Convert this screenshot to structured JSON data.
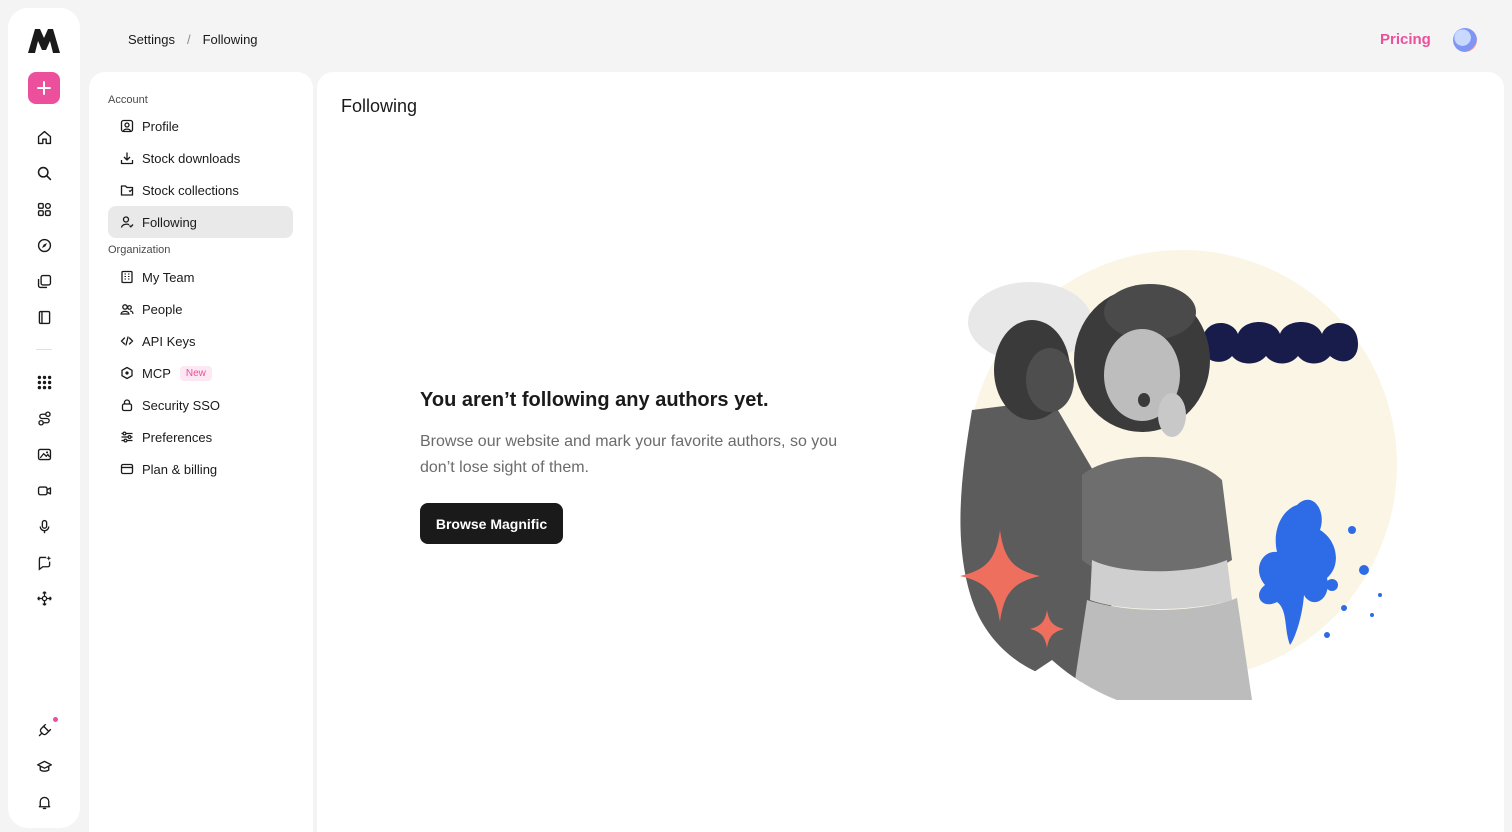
{
  "rail": {
    "logo": "magnific-logo",
    "create_icon": "plus-icon",
    "items": [
      {
        "name": "home-icon"
      },
      {
        "name": "search-icon"
      },
      {
        "name": "apps-icon"
      },
      {
        "name": "compass-icon"
      },
      {
        "name": "collections-icon"
      },
      {
        "name": "book-icon"
      },
      {
        "name": "grid-icon"
      },
      {
        "name": "nodes-icon"
      },
      {
        "name": "image-icon"
      },
      {
        "name": "video-icon"
      },
      {
        "name": "microphone-icon"
      },
      {
        "name": "chat-sparkle-icon"
      },
      {
        "name": "move-icon"
      },
      {
        "name": "plug-icon"
      },
      {
        "name": "graduation-cap-icon"
      },
      {
        "name": "bell-icon"
      }
    ],
    "accent": "#ec4f9c"
  },
  "breadcrumb": {
    "root": "Settings",
    "separator": "/",
    "current": "Following"
  },
  "header": {
    "pricing": "Pricing"
  },
  "settings_nav": {
    "account_label": "Account",
    "organization_label": "Organization",
    "account_items": [
      {
        "label": "Profile",
        "icon": "profile-icon"
      },
      {
        "label": "Stock downloads",
        "icon": "download-icon"
      },
      {
        "label": "Stock collections",
        "icon": "folder-icon"
      },
      {
        "label": "Following",
        "icon": "user-follow-icon",
        "active": true
      }
    ],
    "organization_items": [
      {
        "label": "My Team",
        "icon": "building-icon"
      },
      {
        "label": "People",
        "icon": "people-icon"
      },
      {
        "label": "API Keys",
        "icon": "code-icon"
      },
      {
        "label": "MCP",
        "icon": "mcp-icon",
        "badge": "New"
      },
      {
        "label": "Security SSO",
        "icon": "lock-icon"
      },
      {
        "label": "Preferences",
        "icon": "sliders-icon"
      },
      {
        "label": "Plan & billing",
        "icon": "card-icon"
      }
    ]
  },
  "main": {
    "title": "Following",
    "empty_title": "You aren’t following any authors yet.",
    "empty_description": "Browse our website and mark your favorite authors, so you don’t lose sight of them.",
    "cta": "Browse Magnific"
  }
}
